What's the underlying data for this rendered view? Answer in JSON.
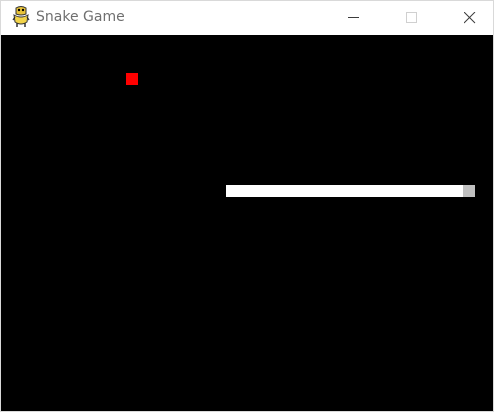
{
  "window": {
    "title": "Snake Game",
    "icon": "python-snake-icon"
  },
  "controls": {
    "minimize_icon": "minimize-icon",
    "maximize_icon": "maximize-icon",
    "close_icon": "close-icon"
  },
  "game": {
    "background_color": "#000000",
    "food_color": "#ff0000",
    "snake_body_color": "#ffffff",
    "snake_head_color": "#c0c0c0",
    "snake_direction": "right"
  }
}
